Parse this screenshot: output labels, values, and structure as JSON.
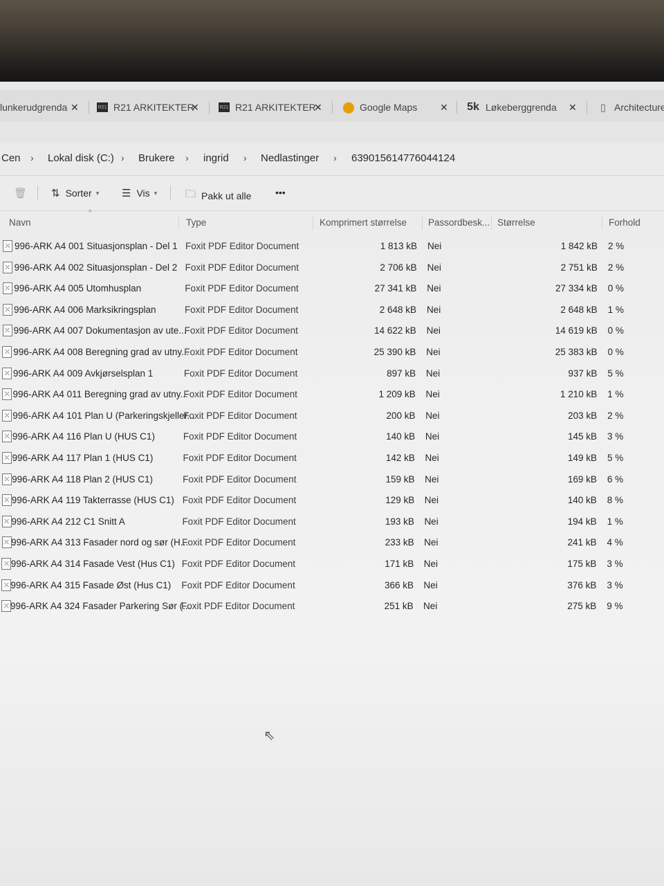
{
  "tabs": [
    {
      "label": "lunkerudgrenda",
      "icon": "page-icon"
    },
    {
      "label": "R21 ARKITEKTER",
      "icon": "r21-logo-icon"
    },
    {
      "label": "R21 ARKITEKTER",
      "icon": "r21-logo-icon"
    },
    {
      "label": "Google Maps",
      "icon": "google-maps-icon"
    },
    {
      "label": "Løkeberggrenda",
      "icon": "sk-logo-icon"
    },
    {
      "label": "Architecture",
      "icon": "document-icon"
    }
  ],
  "tab_close": "✕",
  "breadcrumb": {
    "items": [
      "Cen",
      "Lokal disk (C:)",
      "Brukere",
      "ingrid",
      "Nedlastinger",
      "639015614776044124"
    ],
    "separator": "›"
  },
  "toolbar": {
    "sort_label": "Sorter",
    "view_label": "Vis",
    "extract_label": "Pakk ut alle",
    "more_label": "•••"
  },
  "columns": {
    "name": "Navn",
    "type": "Type",
    "compressed": "Komprimert størrelse",
    "password": "Passordbesk...",
    "size": "Størrelse",
    "ratio": "Forhold"
  },
  "files": [
    {
      "name": "996-ARK A4 001 Situasjonsplan - Del 1",
      "type": "Foxit PDF Editor Document",
      "compressed": "1 813 kB",
      "password": "Nei",
      "size": "1 842 kB",
      "ratio": "2 %"
    },
    {
      "name": "996-ARK A4 002 Situasjonsplan - Del 2",
      "type": "Foxit PDF Editor Document",
      "compressed": "2 706 kB",
      "password": "Nei",
      "size": "2 751 kB",
      "ratio": "2 %"
    },
    {
      "name": "996-ARK A4 005 Utomhusplan",
      "type": "Foxit PDF Editor Document",
      "compressed": "27 341 kB",
      "password": "Nei",
      "size": "27 334 kB",
      "ratio": "0 %"
    },
    {
      "name": "996-ARK A4 006 Marksikringsplan",
      "type": "Foxit PDF Editor Document",
      "compressed": "2 648 kB",
      "password": "Nei",
      "size": "2 648 kB",
      "ratio": "1 %"
    },
    {
      "name": "996-ARK A4 007 Dokumentasjon av ute...",
      "type": "Foxit PDF Editor Document",
      "compressed": "14 622 kB",
      "password": "Nei",
      "size": "14 619 kB",
      "ratio": "0 %"
    },
    {
      "name": "996-ARK A4 008 Beregning grad av utny...",
      "type": "Foxit PDF Editor Document",
      "compressed": "25 390 kB",
      "password": "Nei",
      "size": "25 383 kB",
      "ratio": "0 %"
    },
    {
      "name": "996-ARK A4 009 Avkjørselsplan 1",
      "type": "Foxit PDF Editor Document",
      "compressed": "897 kB",
      "password": "Nei",
      "size": "937 kB",
      "ratio": "5 %"
    },
    {
      "name": "996-ARK A4 011 Beregning grad av utny...",
      "type": "Foxit PDF Editor Document",
      "compressed": "1 209 kB",
      "password": "Nei",
      "size": "1 210 kB",
      "ratio": "1 %"
    },
    {
      "name": "996-ARK A4 101 Plan U (Parkeringskjeller...",
      "type": "Foxit PDF Editor Document",
      "compressed": "200 kB",
      "password": "Nei",
      "size": "203 kB",
      "ratio": "2 %"
    },
    {
      "name": "996-ARK A4 116 Plan U (HUS C1)",
      "type": "Foxit PDF Editor Document",
      "compressed": "140 kB",
      "password": "Nei",
      "size": "145 kB",
      "ratio": "3 %"
    },
    {
      "name": "996-ARK A4 117 Plan 1 (HUS C1)",
      "type": "Foxit PDF Editor Document",
      "compressed": "142 kB",
      "password": "Nei",
      "size": "149 kB",
      "ratio": "5 %"
    },
    {
      "name": "996-ARK A4 118 Plan 2 (HUS C1)",
      "type": "Foxit PDF Editor Document",
      "compressed": "159 kB",
      "password": "Nei",
      "size": "169 kB",
      "ratio": "6 %"
    },
    {
      "name": "996-ARK A4 119 Takterrasse (HUS C1)",
      "type": "Foxit PDF Editor Document",
      "compressed": "129 kB",
      "password": "Nei",
      "size": "140 kB",
      "ratio": "8 %"
    },
    {
      "name": "996-ARK A4 212 C1 Snitt A",
      "type": "Foxit PDF Editor Document",
      "compressed": "193 kB",
      "password": "Nei",
      "size": "194 kB",
      "ratio": "1 %"
    },
    {
      "name": "996-ARK A4 313 Fasader nord og sør (H...",
      "type": "Foxit PDF Editor Document",
      "compressed": "233 kB",
      "password": "Nei",
      "size": "241 kB",
      "ratio": "4 %"
    },
    {
      "name": "996-ARK A4 314 Fasade Vest (Hus C1)",
      "type": "Foxit PDF Editor Document",
      "compressed": "171 kB",
      "password": "Nei",
      "size": "175 kB",
      "ratio": "3 %"
    },
    {
      "name": "996-ARK A4 315 Fasade Øst (Hus C1)",
      "type": "Foxit PDF Editor Document",
      "compressed": "366 kB",
      "password": "Nei",
      "size": "376 kB",
      "ratio": "3 %"
    },
    {
      "name": "996-ARK A4 324 Fasader Parkering Sør (...",
      "type": "Foxit PDF Editor Document",
      "compressed": "251 kB",
      "password": "Nei",
      "size": "275 kB",
      "ratio": "9 %"
    }
  ]
}
